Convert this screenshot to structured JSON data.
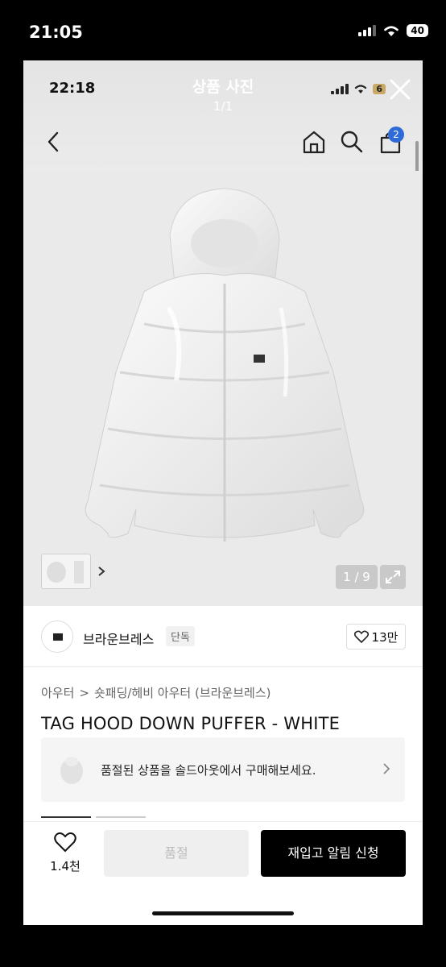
{
  "outer_status": {
    "time": "21:05",
    "battery": "40"
  },
  "viewer": {
    "title": "상품 사진",
    "counter": "1/1",
    "inner_time": "22:18",
    "inner_battery": "6"
  },
  "nav": {
    "cart_count": "2"
  },
  "gallery": {
    "counter": "1 / 9"
  },
  "brand": {
    "name": "브라운브레스",
    "tag": "단독",
    "likes": "13만"
  },
  "breadcrumb": {
    "category": "아우터",
    "separator": ">",
    "subcategory": "숏패딩/헤비 아우터 (브라운브레스)"
  },
  "product": {
    "title": "TAG HOOD DOWN PUFFER - WHITE"
  },
  "sold_out_banner": {
    "text": "품절된 상품을 솔드아웃에서 구매해보세요."
  },
  "bottom": {
    "wish_count": "1.4천",
    "soldout_label": "품절",
    "restock_label": "재입고 알림 신청"
  },
  "colors": {
    "accent": "#2f6bd7",
    "primary_button": "#000000",
    "disabled_button": "#efefef"
  },
  "icons": [
    "back-arrow-icon",
    "home-icon",
    "search-icon",
    "cart-icon",
    "close-icon",
    "heart-icon",
    "expand-icon",
    "chevron-right-icon"
  ]
}
